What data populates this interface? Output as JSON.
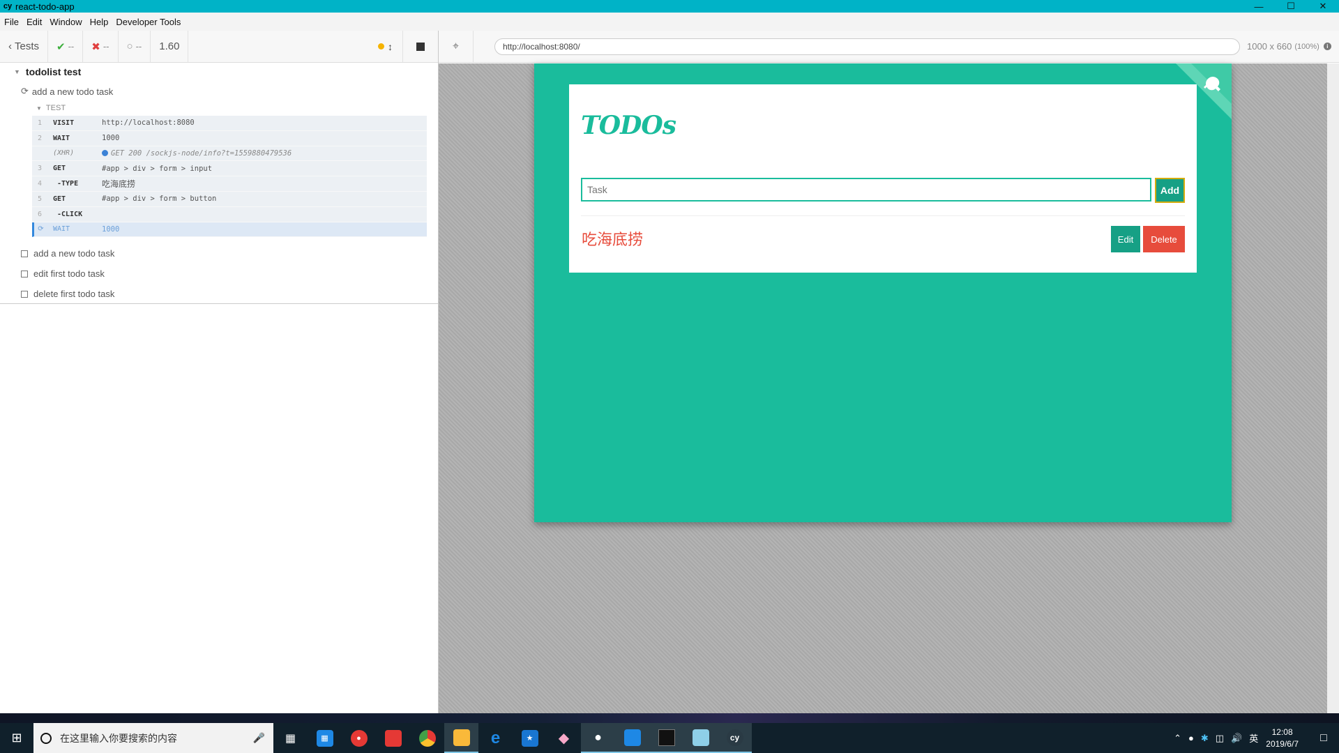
{
  "window": {
    "title": "react-todo-app",
    "app_icon": "cy",
    "controls": [
      "—",
      "☐",
      "✕"
    ]
  },
  "menu": [
    "File",
    "Edit",
    "Window",
    "Help",
    "Developer Tools"
  ],
  "reporter": {
    "back_label": "Tests",
    "passed": "--",
    "failed": "--",
    "pending": "--",
    "duration": "1.60",
    "suite_title": "todolist test",
    "running_test": "add a new todo task",
    "test_section": "TEST",
    "commands": [
      {
        "num": "1",
        "name": "VISIT",
        "msg": "http://localhost:8080",
        "kind": "normal"
      },
      {
        "num": "2",
        "name": "WAIT",
        "msg": "1000",
        "kind": "normal"
      },
      {
        "num": "",
        "name": "(XHR)",
        "msg": "GET 200 /sockjs-node/info?t=1559880479536",
        "kind": "xhr"
      },
      {
        "num": "3",
        "name": "GET",
        "msg": "#app > div > form > input",
        "kind": "normal"
      },
      {
        "num": "4",
        "name": "-TYPE",
        "msg": "吃海底捞",
        "kind": "child"
      },
      {
        "num": "5",
        "name": "GET",
        "msg": "#app > div > form > button",
        "kind": "normal"
      },
      {
        "num": "6",
        "name": "-CLICK",
        "msg": "",
        "kind": "child"
      },
      {
        "num": "",
        "name": "WAIT",
        "msg": "1000",
        "kind": "active"
      }
    ],
    "pending_tests": [
      "add a new todo task",
      "edit first todo task",
      "delete first todo task"
    ]
  },
  "aut": {
    "url": "http://localhost:8080/",
    "viewport": "1000 x 660",
    "scale": "(100%)"
  },
  "app": {
    "title": "TODOs",
    "input_placeholder": "Task",
    "add_label": "Add",
    "todo_item": "吃海底捞",
    "edit_label": "Edit",
    "delete_label": "Delete",
    "accent": "#1abc9c",
    "danger": "#e74c3c"
  },
  "taskbar": {
    "search_placeholder": "在这里输入你要搜索的内容",
    "ime": "英",
    "time": "12:08",
    "date": "2019/6/7",
    "icons": [
      "task-view-icon",
      "store-icon",
      "netease-music-icon",
      "youdao-icon",
      "chrome-icon",
      "file-explorer-icon",
      "edge-icon",
      "pinned-app-icon",
      "sketch-icon",
      "wechat-icon",
      "vscode-icon",
      "terminal-icon",
      "notepad-icon",
      "cypress-icon"
    ]
  }
}
